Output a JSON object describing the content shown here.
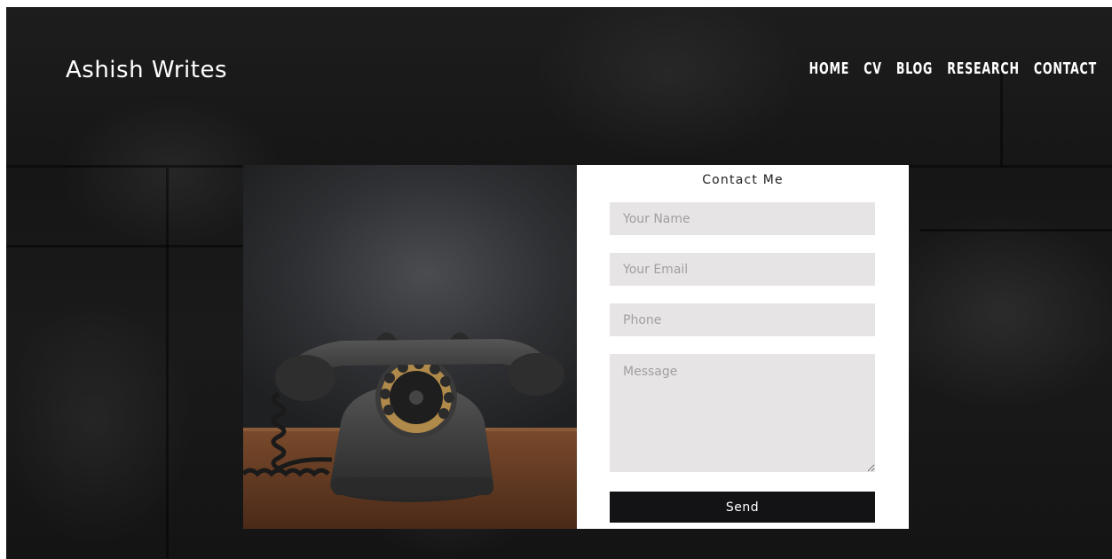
{
  "site": {
    "brand": "Ashish Writes"
  },
  "nav": {
    "items": [
      {
        "label": "HOME"
      },
      {
        "label": "CV"
      },
      {
        "label": "BLOG"
      },
      {
        "label": "RESEARCH"
      },
      {
        "label": "CONTACT"
      }
    ]
  },
  "contact": {
    "title": "Contact Me",
    "name_placeholder": "Your Name",
    "email_placeholder": "Your Email",
    "phone_placeholder": "Phone",
    "message_placeholder": "Message",
    "send_label": "Send"
  },
  "colors": {
    "field_bg": "#e6e4e5",
    "button_bg": "#131316",
    "text_light": "#ffffff"
  },
  "image": {
    "icon": "rotary-telephone-photo"
  }
}
